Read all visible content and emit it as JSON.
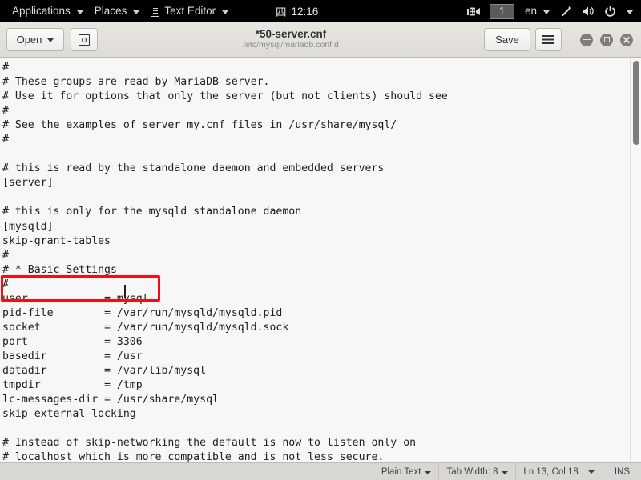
{
  "top_panel": {
    "applications_label": "Applications",
    "places_label": "Places",
    "app_name_label": "Text Editor",
    "app_icon": "notepad-icon",
    "clock_day": "四",
    "clock_time": "12:16",
    "screencast_icon": "screencast-recorder-icon",
    "workspace_label": "1",
    "keyboard_layout": "en",
    "pen_icon": "stylus-icon",
    "volume_icon": "volume-speaker-icon",
    "power_icon": "power-icon"
  },
  "headerbar": {
    "open_label": "Open",
    "save_as_icon": "save-as-icon",
    "save_label": "Save",
    "menu_icon": "hamburger-menu-icon",
    "title": "*50-server.cnf",
    "subtitle": "/etc/mysql/mariadb.conf.d",
    "minimize_icon": "minimize-icon",
    "maximize_icon": "maximize-icon",
    "close_icon": "close-icon"
  },
  "editor": {
    "lines": [
      "#",
      "# These groups are read by MariaDB server.",
      "# Use it for options that only the server (but not clients) should see",
      "#",
      "# See the examples of server my.cnf files in /usr/share/mysql/",
      "#",
      "",
      "# this is read by the standalone daemon and embedded servers",
      "[server]",
      "",
      "# this is only for the mysqld standalone daemon",
      "[mysqld]",
      "skip-grant-tables",
      "#",
      "# * Basic Settings",
      "#",
      "user            = mysql",
      "pid-file        = /var/run/mysqld/mysqld.pid",
      "socket          = /var/run/mysqld/mysqld.sock",
      "port            = 3306",
      "basedir         = /usr",
      "datadir         = /var/lib/mysql",
      "tmpdir          = /tmp",
      "lc-messages-dir = /usr/share/mysql",
      "skip-external-locking",
      "",
      "# Instead of skip-networking the default is now to listen only on",
      "# localhost which is more compatible and is not less secure."
    ],
    "annotation_color": "#ee1111",
    "annotation_target": "skip-grant-tables"
  },
  "statusbar": {
    "language_label": "Plain Text",
    "tab_width_label": "Tab Width: 8",
    "position_label": "Ln 13, Col 18",
    "insert_mode_label": "INS"
  }
}
